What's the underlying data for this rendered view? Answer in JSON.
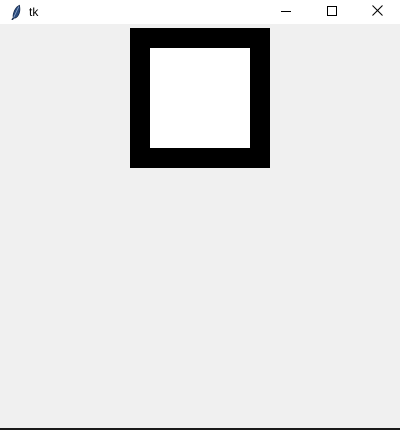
{
  "window": {
    "title": "tk",
    "controls": {
      "minimize_icon": "minimize-icon",
      "maximize_icon": "maximize-icon",
      "close_icon": "close-icon"
    }
  },
  "canvas": {
    "outer_color": "#000000",
    "inner_color": "#ffffff",
    "background": "#f0f0f0"
  }
}
